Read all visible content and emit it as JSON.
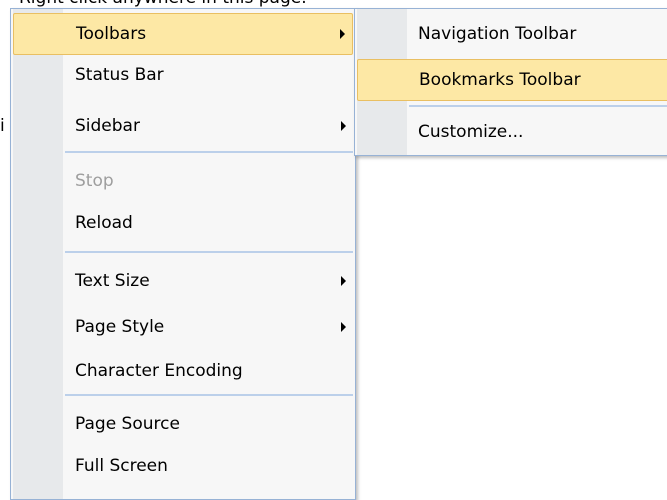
{
  "page": {
    "hint_text": "Right click anywhere in this page.",
    "fragment_text": "i"
  },
  "context_menu": {
    "items": [
      {
        "label": "Toolbars"
      },
      {
        "label": "Status Bar"
      },
      {
        "label": "Sidebar"
      },
      {
        "label": "Stop"
      },
      {
        "label": "Reload"
      },
      {
        "label": "Text Size"
      },
      {
        "label": "Page Style"
      },
      {
        "label": "Character Encoding"
      },
      {
        "label": "Page Source"
      },
      {
        "label": "Full Screen"
      }
    ]
  },
  "toolbars_submenu": {
    "items": [
      {
        "label": "Navigation Toolbar"
      },
      {
        "label": "Bookmarks Toolbar"
      },
      {
        "label": "Customize..."
      }
    ]
  }
}
